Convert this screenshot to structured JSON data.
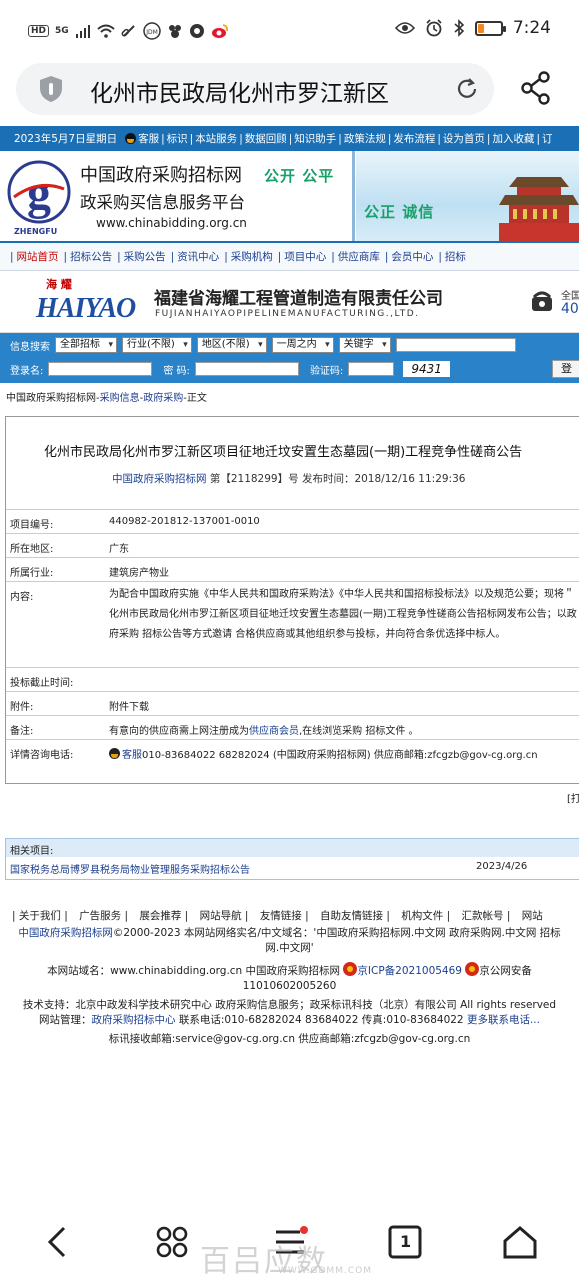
{
  "status_bar": {
    "left_items": [
      "HD",
      "5G",
      "signal",
      "wifi",
      "link",
      "JDM",
      "app",
      "app",
      "weibo"
    ],
    "time": "7:24",
    "battery_level": 0.25
  },
  "browser": {
    "address_text": "化州市民政局化州市罗江新区",
    "accent": "#1b6fb5"
  },
  "topnav": {
    "date": "2023年5月7日星期日",
    "items": [
      "客服",
      "标识",
      "本站服务",
      "数据回顾",
      "知识助手",
      "政策法规",
      "发布流程",
      "设为首页",
      "加入收藏",
      "订"
    ]
  },
  "banner": {
    "title": "中国政府采购招标网",
    "subtitle": "政采购买信息服务平台",
    "url": "www.chinabidding.org.cn",
    "logo_sub": "ZHENGFU",
    "slogan1": "公开 公平",
    "slogan2": "公正 诚信"
  },
  "mainnav": {
    "items": [
      "网站首页",
      "招标公告",
      "采购公告",
      "资讯中心",
      "采购机构",
      "项目中心",
      "供应商库",
      "会员中心",
      "招标"
    ]
  },
  "ad": {
    "brand_cn": "海 耀",
    "brand": "HAIYAO",
    "name": "福建省海耀工程管道制造有限责任公司",
    "name_en": "FUJIANHAIYAOPIPELINEMANUFACTURING.,LTD.",
    "phone_label": "全国",
    "phone_prefix": "40"
  },
  "search": {
    "label": "信息搜索",
    "selects": [
      "全部招标",
      "行业(不限)",
      "地区(不限)",
      "一周之内",
      "关键字"
    ],
    "login_label": "登录名:",
    "password_label": "密 码:",
    "captcha_label": "验证码:",
    "captcha_value": "9431",
    "login_button": "登"
  },
  "breadcrumb": {
    "home": "中国政府采购招标网",
    "sep1": "-",
    "section": "采购信息",
    "sep2": "-",
    "sub": "政府采购",
    "tail": "-正文"
  },
  "article": {
    "title": "化州市民政局化州市罗江新区项目征地迁坟安置生态墓园(一期)工程竞争性磋商公告",
    "meta_site": "中国政府采购招标网",
    "meta_rest": " 第【2118299】号 发布时间：2018/12/16 11:29:36",
    "fields": [
      {
        "label": "项目编号:",
        "value": "440982-201812-137001-0010"
      },
      {
        "label": "所在地区:",
        "value": "广东"
      },
      {
        "label": "所属行业:",
        "value": "建筑房产物业"
      },
      {
        "label": "内容:",
        "value": "为配合中国政府实施《中华人民共和国政府采购法》《中华人民共和国招标投标法》以及规范公要；现将＂化州市民政局化州市罗江新区项目征地迁坟安置生态墓园(一期)工程竞争性磋商公告招标网发布公告；以政府采购 招标公告等方式邀请 合格供应商或其他组织参与投标，并向符合条优选择中标人。"
      },
      {
        "label": "投标截止时间:",
        "value": ""
      },
      {
        "label": "附件:",
        "value": "附件下载"
      },
      {
        "label": "备注:",
        "value_pre": "有意向的供应商需上网注册成为",
        "value_link": "供应商会员",
        "value_post": ",在线浏览采购 招标文件 。"
      },
      {
        "label": "详情咨询电话:",
        "value_link": "客服",
        "value_post": "010-83684022 68282024 (中国政府采购招标网) 供应商邮箱:zfcgzb@gov-cg.org.cn"
      }
    ],
    "print": "[打"
  },
  "related": {
    "header": "相关项目:",
    "items": [
      {
        "title": "国家税务总局博罗县税务局物业管理服务采购招标公告",
        "date": "2023/4/26"
      }
    ]
  },
  "footer": {
    "links": [
      "| 关于我们 |",
      "广告服务 |",
      "展会推荐 |",
      "网站导航 |",
      "友情链接 |",
      "自助友情链接 |",
      "机构文件 |",
      "汇款帐号 |",
      "网站"
    ],
    "copyright_link": "中国政府采购招标网",
    "copyright_rest": "©2000-2023 本网站网络实名/中文域名：'中国政府采购招标网.中文网 政府采购网.中文网 招标网.中文网'",
    "domain_line": "本网站域名：www.chinabidding.org.cn 中国政府采购招标网",
    "icp": "京ICP备2021005469",
    "police": "京公网安备",
    "police_no": "11010602005260",
    "tech": "技术支持：北京中政发科学技术研究中心 政府采购信息服务；政采标讯科技（北京）有限公司 All rights reserved",
    "admin_pre": "网站管理：",
    "admin_link": "政府采购招标中心",
    "admin_rest": " 联系电话:010-68282024 83684022 传真:010-83684022 ",
    "more_link": "更多联系电话...",
    "email": "标讯接收邮箱:service@gov-cg.org.cn 供应商邮箱:zfcgzb@gov-cg.org.cn"
  },
  "bottom_nav": {
    "tab_count": "1",
    "watermark": "百吕应数",
    "watermark_url": "WWW.GDMM.COM"
  }
}
